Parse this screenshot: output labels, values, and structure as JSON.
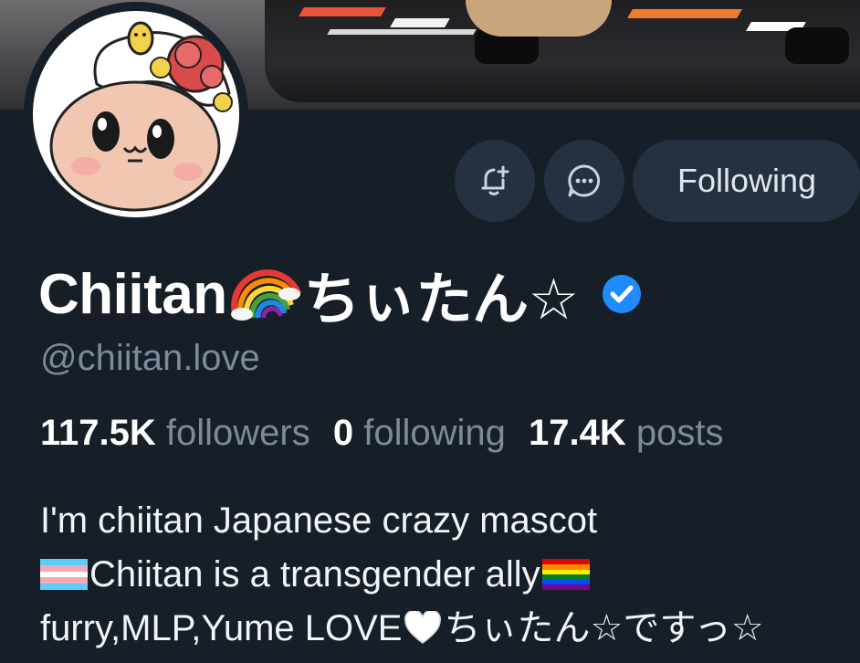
{
  "profile": {
    "display_name_latin": "Chiitan",
    "display_name_jp": "ちぃたん☆",
    "handle": "@chiitan.love",
    "stats": {
      "followers_count": "117.5K",
      "followers_label": "followers",
      "following_count": "0",
      "following_label": "following",
      "posts_count": "17.4K",
      "posts_label": "posts"
    },
    "bio": {
      "line1": "I'm chiitan Japanese crazy mascot",
      "line2": "Chiitan is a transgender ally",
      "line3_a": "furry,MLP,Yume LOVE",
      "line3_b": "ちぃたん☆ですっ☆"
    }
  },
  "actions": {
    "follow_label": "Following",
    "subscribe_icon": "bell-plus-icon",
    "message_icon": "chat-bubble-icon"
  },
  "colors": {
    "background": "#161e27",
    "button_bg": "#253140",
    "muted_text": "#7c8a9b",
    "verified_blue": "#208bfe"
  }
}
